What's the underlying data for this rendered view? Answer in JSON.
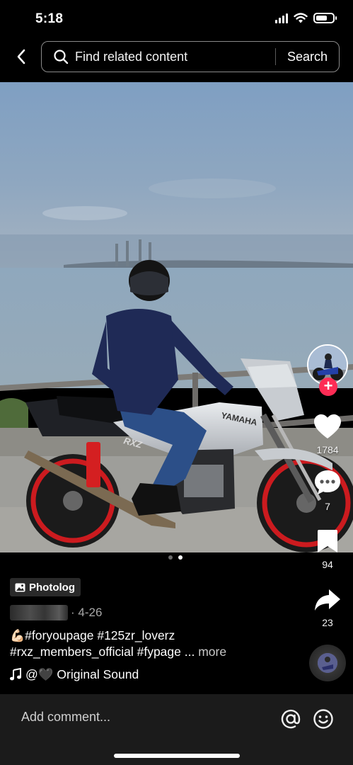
{
  "status_bar": {
    "time": "5:18"
  },
  "search": {
    "placeholder": "Find related content",
    "button_label": "Search"
  },
  "post": {
    "photo_index": 2,
    "photo_count": 2,
    "type_tag": "Photolog",
    "date": "· 4-26",
    "caption_line1": "#foryoupage #125zr_loverz",
    "caption_line2": "#rxz_members_official #fypage ...",
    "more_label": "more",
    "sound": "@🖤 Original Sound",
    "photo_text": {
      "brand": "YAMAHA",
      "model": "RXZ"
    }
  },
  "actions": {
    "likes": "1784",
    "comments": "7",
    "saves": "94",
    "shares": "23"
  },
  "comment_bar": {
    "placeholder": "Add comment..."
  },
  "icons": [
    "back-icon",
    "search-icon",
    "photolog-icon",
    "heart-icon",
    "comment-icon",
    "bookmark-icon",
    "share-icon",
    "music-note-icon",
    "at-icon",
    "emoji-icon"
  ],
  "colors": {
    "follow_accent": "#fe2c55",
    "background": "#000000",
    "comment_bar": "#1b1b1b"
  }
}
